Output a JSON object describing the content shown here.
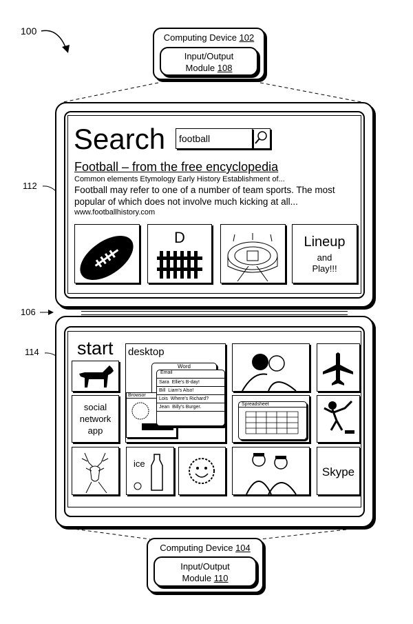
{
  "figure_label": "100",
  "top_device": {
    "title": "Computing Device",
    "ref": "102",
    "module_line1": "Input/Output",
    "module_line2": "Module",
    "module_ref": "108"
  },
  "bottom_device": {
    "title": "Computing Device",
    "ref": "104",
    "module_line1": "Input/Output",
    "module_line2": "Module",
    "module_ref": "110"
  },
  "refs": {
    "upper_display": "112",
    "hinge": "106",
    "lower_display": "114"
  },
  "search": {
    "heading": "Search",
    "query": "football",
    "search_icon": "magnifier-icon",
    "result_title": "Football – from the free encyclopedia",
    "result_sections": "Common elements  Etymology Early History Establishment of...",
    "result_snippet": "Football may refer to one of a number of team sports.  The most popular of which does not involve much kicking at all...",
    "result_url": "www.footballhistory.com",
    "tiles": [
      {
        "icon": "football-icon"
      },
      {
        "label": "D",
        "icon": "fence-icon"
      },
      {
        "icon": "stadium-icon"
      },
      {
        "label": "Lineup",
        "sub": "and Play!!!"
      }
    ]
  },
  "start": {
    "heading": "start",
    "desktop_label": "desktop",
    "windows": {
      "word": "Word",
      "email": "Email",
      "browser": "Browsor",
      "spreadsheet": "Spreadsheet"
    },
    "emails": [
      {
        "from": "Sara",
        "subject": "Ellie's B-day!"
      },
      {
        "from": "Bill",
        "subject": "Liam's Also!"
      },
      {
        "from": "Lois",
        "subject": "Where's Richard?"
      },
      {
        "from": "Jean",
        "subject": "Billy's Burger."
      }
    ],
    "social_label": "social network app",
    "ice_label": "ice",
    "skype_label": "Skype",
    "tile_icons": [
      "dog-icon",
      "deer-icon",
      "shaker-icon",
      "sun-icon",
      "couple-icon",
      "people-icon",
      "airplane-icon",
      "monkey-icon"
    ]
  }
}
